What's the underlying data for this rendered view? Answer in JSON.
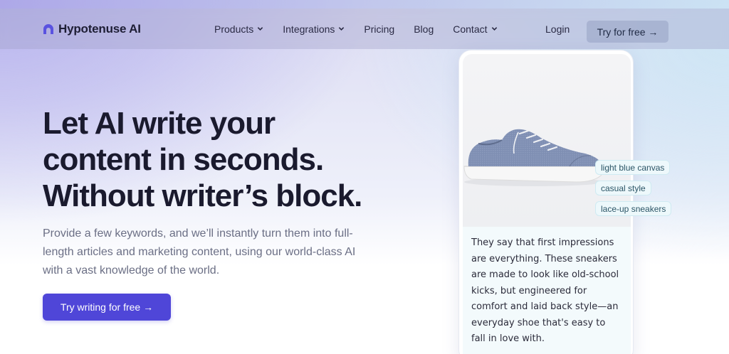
{
  "brand": {
    "name": "Hypotenuse AI",
    "accent": "#4f46d8",
    "logo_color": "#5a52e0"
  },
  "nav": {
    "items": [
      {
        "label": "Products",
        "has_dropdown": true
      },
      {
        "label": "Integrations",
        "has_dropdown": true
      },
      {
        "label": "Pricing",
        "has_dropdown": false
      },
      {
        "label": "Blog",
        "has_dropdown": false
      },
      {
        "label": "Contact",
        "has_dropdown": true
      }
    ],
    "login_label": "Login",
    "cta_label": "Try for free →"
  },
  "hero": {
    "title_lines": [
      "Let AI write your",
      "content in seconds.",
      "Without writer’s block."
    ],
    "subtitle": "Provide a few keywords, and we’ll instantly turn them into full-length articles and marketing content, using our world-class AI with a vast knowledge of the world.",
    "cta_label": "Try writing for free →"
  },
  "product_card": {
    "image_icon": "sneaker-image",
    "keywords": [
      "light blue canvas",
      "casual style",
      "lace-up sneakers"
    ],
    "generated_text": "They say that first impressions are everything. These sneakers are made to look like old-school kicks, but engineered for comfort and laid back style—an everyday shoe that's easy to fall in love with."
  }
}
